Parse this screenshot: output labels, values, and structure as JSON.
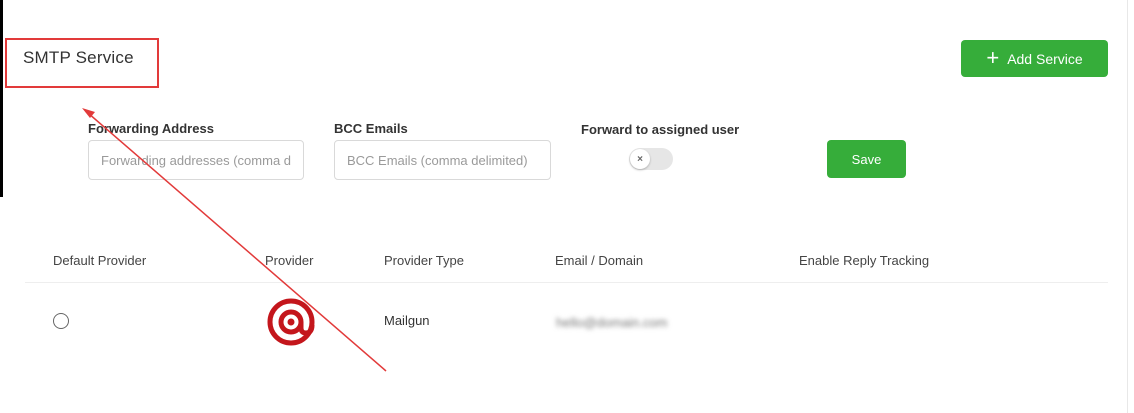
{
  "page": {
    "title": "SMTP Service"
  },
  "toolbar": {
    "add_service_label": "Add Service"
  },
  "settings": {
    "forwarding_label": "Forwarding Address",
    "forwarding_placeholder": "Forwarding addresses (comma delimited)",
    "bcc_label": "BCC Emails",
    "bcc_placeholder": "BCC Emails (comma delimited)",
    "forward_assigned_label": "Forward to assigned user",
    "forward_assigned_enabled": false,
    "save_label": "Save"
  },
  "table": {
    "headers": {
      "default_provider": "Default Provider",
      "provider": "Provider",
      "provider_type": "Provider Type",
      "email_domain": "Email / Domain",
      "reply_tracking": "Enable Reply Tracking"
    },
    "rows": [
      {
        "default": false,
        "provider_icon": "mailgun-logo",
        "provider_type": "Mailgun",
        "email": "hello@domain.com"
      }
    ]
  },
  "colors": {
    "accent_green": "#36ad3a",
    "annotation_red": "#e23a3a",
    "mailgun_red": "#c4161c"
  }
}
